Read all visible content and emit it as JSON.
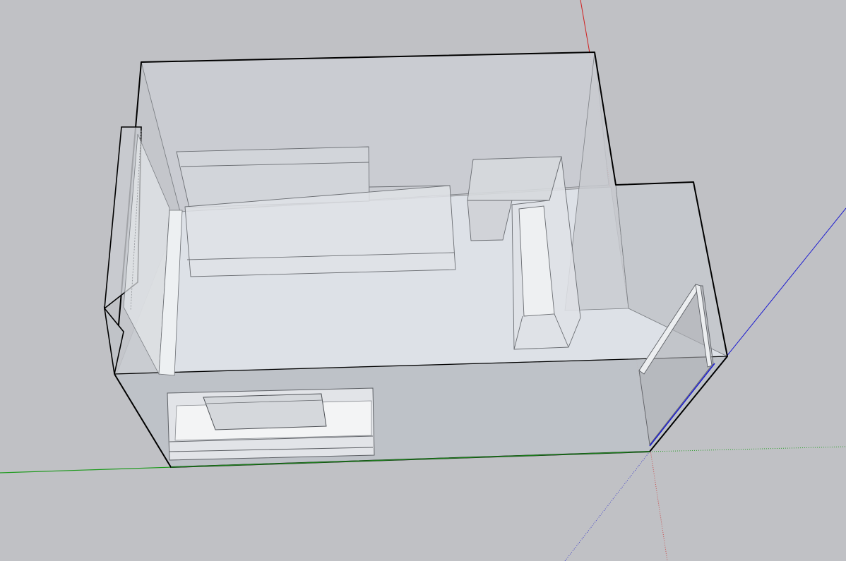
{
  "scene": {
    "type": "3d-modeling-viewport",
    "view": "perspective",
    "style": "x-ray",
    "colors": {
      "background": "#c0c1c5",
      "red_axis": "#d02020",
      "green_axis": "#1d9a1d",
      "blue_axis": "#1a1ad0",
      "edge": "#000000",
      "face": "#dde1e6"
    },
    "objects": [
      "room-box",
      "left-window-box",
      "back-cabinet",
      "long-counter",
      "right-cabinet",
      "right-counter",
      "right-wall-extension",
      "door-frame",
      "front-bench",
      "front-bench-top"
    ]
  }
}
